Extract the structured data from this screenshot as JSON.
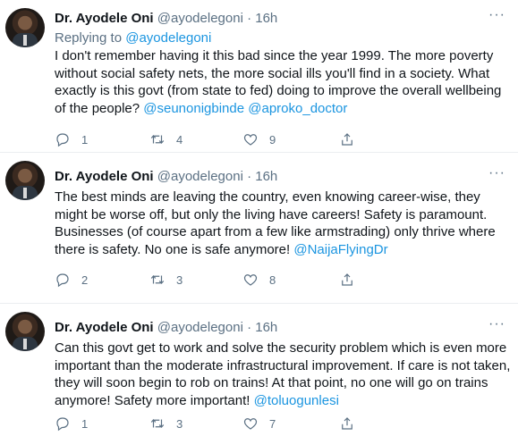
{
  "tweets": [
    {
      "name": "Dr. Ayodele Oni",
      "handle": "@ayodelegoni",
      "time": "16h",
      "replying_to_label": "Replying to",
      "replying_to": "@ayodelegoni",
      "text": "I don't remember having it this bad since the year 1999. The more poverty without social safety nets, the more social ills you'll find in a society. What exactly is this govt (from state to fed) doing to improve the overall wellbeing of the people?",
      "mentions": [
        "@seunonigbinde",
        "@aproko_doctor"
      ],
      "replies": "1",
      "retweets": "4",
      "likes": "9"
    },
    {
      "name": "Dr. Ayodele Oni",
      "handle": "@ayodelegoni",
      "time": "16h",
      "text": "The best minds are leaving the country, even knowing career-wise, they might be worse off, but only the living have careers! Safety is paramount. Businesses (of course apart from a few like armstrading) only thrive where there is safety. No one is safe anymore!",
      "mentions": [
        "@NaijaFlyingDr"
      ],
      "replies": "2",
      "retweets": "3",
      "likes": "8"
    },
    {
      "name": "Dr. Ayodele Oni",
      "handle": "@ayodelegoni",
      "time": "16h",
      "text": "Can this govt get to work and solve the security problem which is even more important than the moderate infrastructural improvement. If care is not taken, they will soon begin to rob on trains! At that point, no one will go on trains anymore! Safety more important!",
      "mentions": [
        "@toluogunlesi"
      ],
      "replies": "1",
      "retweets": "3",
      "likes": "7"
    }
  ],
  "separator": "·",
  "more_glyph": "···",
  "colors": {
    "link": "#1b95e0",
    "muted": "#5b7083",
    "text": "#0f1419"
  },
  "icons": [
    "reply-icon",
    "retweet-icon",
    "like-icon",
    "share-icon",
    "more-icon"
  ]
}
